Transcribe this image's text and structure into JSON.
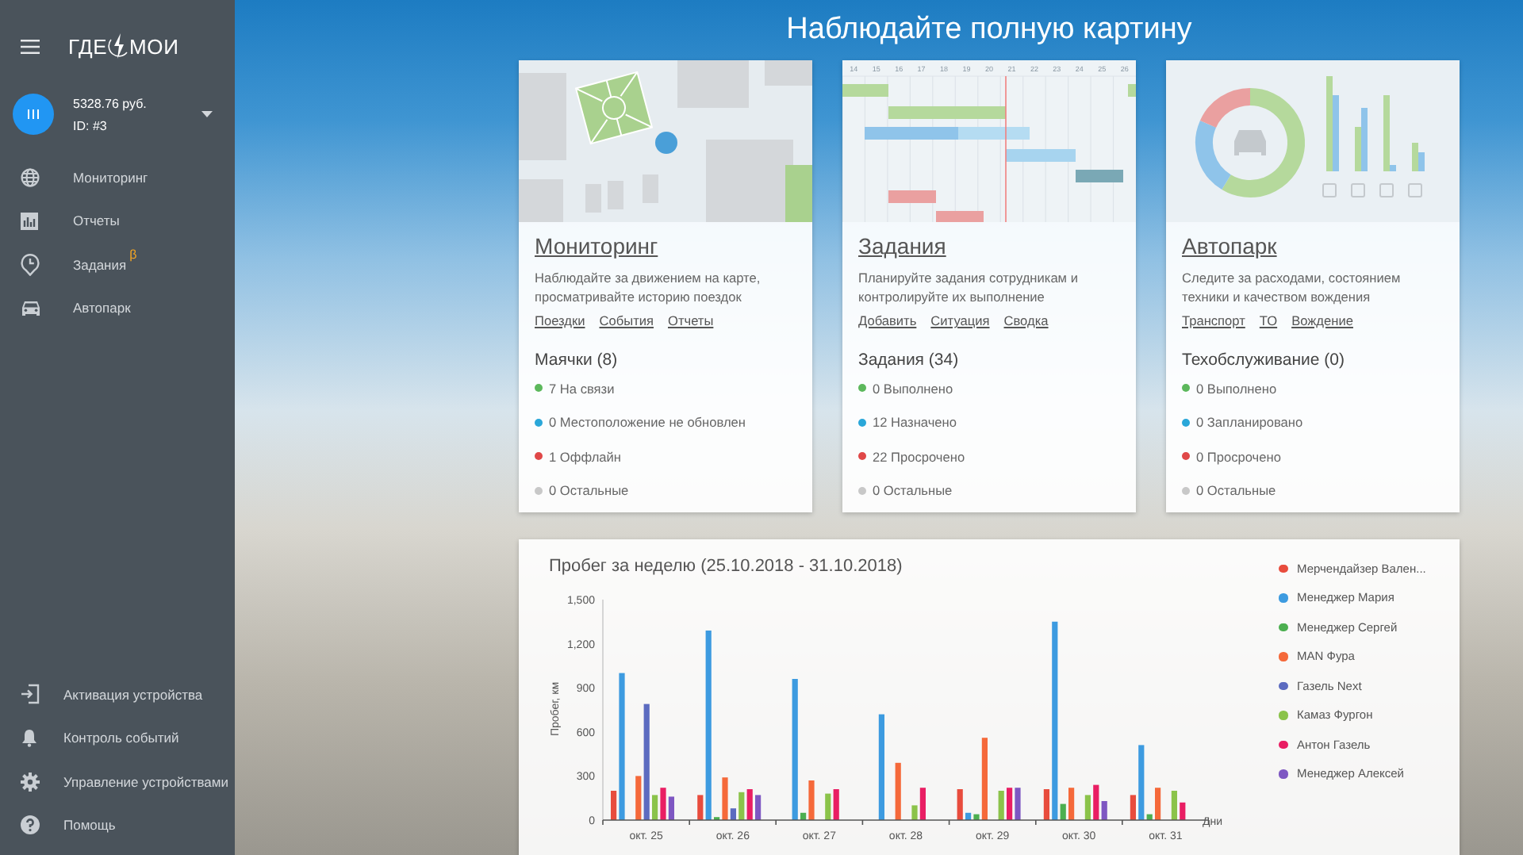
{
  "sidebar": {
    "logo": {
      "left": "ГДЕ",
      "right": "МОИ"
    },
    "account": {
      "balance": "5328.76 руб.",
      "id": "ID: #3"
    },
    "nav_items": [
      {
        "kind": "globe",
        "label": "Мониторинг"
      },
      {
        "kind": "chart",
        "label": "Отчеты"
      },
      {
        "kind": "clock",
        "label": "Задания",
        "badge": "β"
      },
      {
        "kind": "car",
        "label": "Автопарк"
      }
    ],
    "bottom_items": [
      {
        "kind": "enter",
        "label": "Активация устройства"
      },
      {
        "kind": "bell",
        "label": "Контроль событий"
      },
      {
        "kind": "gear",
        "label": "Управление устройствами"
      },
      {
        "kind": "help",
        "label": "Помощь"
      }
    ]
  },
  "page_title": "Наблюдайте полную картину",
  "cards": [
    {
      "kind": "map",
      "title": "Мониторинг",
      "description": "Наблюдайте за движением на карте, просматривайте историю поездок",
      "links": [
        "Поездки",
        "События",
        "Отчеты"
      ],
      "section_title": "Маячки (8)",
      "statuses": [
        {
          "label": "7 На связи",
          "color": "#5cb85c"
        },
        {
          "label": "0 Местоположение не обновлен",
          "color": "#2aa7d9"
        },
        {
          "label": "1 Оффлайн",
          "color": "#e04848"
        },
        {
          "label": "0 Остальные",
          "color": "#c8c8c8"
        }
      ]
    },
    {
      "kind": "gantt",
      "day_labels": [
        "14",
        "15",
        "16",
        "17",
        "18",
        "19",
        "20",
        "21",
        "22",
        "23",
        "24",
        "25",
        "26"
      ],
      "title": "Задания",
      "description": "Планируйте задания сотрудникам и контролируйте их выполнение",
      "links": [
        "Добавить",
        "Ситуация",
        "Сводка"
      ],
      "section_title": "Задания (34)",
      "statuses": [
        {
          "label": "0 Выполнено",
          "color": "#5cb85c"
        },
        {
          "label": "12 Назначено",
          "color": "#2aa7d9"
        },
        {
          "label": "22 Просрочено",
          "color": "#e04848"
        },
        {
          "label": "0 Остальные",
          "color": "#c8c8c8"
        }
      ]
    },
    {
      "kind": "fleet",
      "title": "Автопарк",
      "description": "Следите за расходами, состоянием техники и качеством вождения",
      "links": [
        "Транспорт",
        "ТО",
        "Вождение"
      ],
      "section_title": "Техобслуживание (0)",
      "statuses": [
        {
          "label": "0 Выполнено",
          "color": "#5cb85c"
        },
        {
          "label": "0 Запланировано",
          "color": "#2aa7d9"
        },
        {
          "label": "0 Просрочено",
          "color": "#e04848"
        },
        {
          "label": "0 Остальные",
          "color": "#c8c8c8"
        }
      ]
    }
  ],
  "mileage_chart": {
    "chart_data": {
      "type": "bar",
      "title": "Пробег за неделю (25.10.2018 - 31.10.2018)",
      "xlabel": "Дни",
      "ylabel": "Пробег, км",
      "categories": [
        "окт. 25",
        "окт. 26",
        "окт. 27",
        "окт. 28",
        "окт. 29",
        "окт. 30",
        "окт. 31"
      ],
      "ylim": [
        0,
        1500
      ],
      "yticks": [
        {
          "value": 0,
          "label": "0"
        },
        {
          "value": 300,
          "label": "300"
        },
        {
          "value": 600,
          "label": "600"
        },
        {
          "value": 900,
          "label": "900"
        },
        {
          "value": 1200,
          "label": "1,200"
        },
        {
          "value": 1500,
          "label": "1,500"
        }
      ],
      "series": [
        {
          "name": "Мерчендайзер Вален...",
          "color": "#e84c3d",
          "values": [
            200,
            170,
            null,
            null,
            210,
            210,
            170
          ]
        },
        {
          "name": "Менеджер Мария",
          "color": "#3d9be0",
          "values": [
            1000,
            1290,
            960,
            720,
            50,
            1350,
            510
          ]
        },
        {
          "name": "Менеджер Сергей",
          "color": "#4caf50",
          "values": [
            null,
            20,
            50,
            null,
            40,
            110,
            40
          ]
        },
        {
          "name": "MAN Фура",
          "color": "#f5693a",
          "values": [
            300,
            290,
            270,
            390,
            560,
            220,
            220
          ]
        },
        {
          "name": "Газель Next",
          "color": "#5c6bc0",
          "values": [
            790,
            80,
            null,
            null,
            null,
            null,
            null
          ]
        },
        {
          "name": "Камаз Фургон",
          "color": "#8bc34a",
          "values": [
            170,
            190,
            180,
            100,
            200,
            170,
            200
          ]
        },
        {
          "name": "Антон Газель",
          "color": "#e91e63",
          "values": [
            220,
            210,
            210,
            220,
            220,
            240,
            120
          ]
        },
        {
          "name": "Менеджер Алексей",
          "color": "#7e57c2",
          "values": [
            160,
            170,
            null,
            null,
            220,
            130,
            null
          ]
        }
      ]
    }
  }
}
